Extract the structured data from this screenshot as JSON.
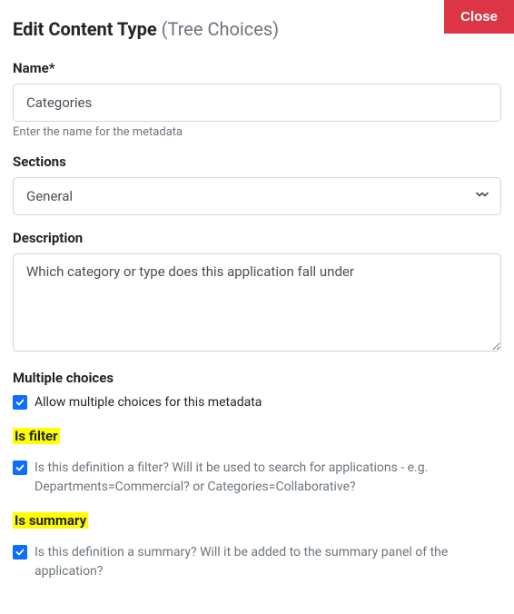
{
  "header": {
    "title": "Edit Content Type",
    "subtitle": "(Tree Choices)",
    "close_label": "Close"
  },
  "name": {
    "label": "Name*",
    "value": "Categories",
    "help": "Enter the name for the metadata"
  },
  "sections": {
    "label": "Sections",
    "value": "General"
  },
  "description": {
    "label": "Description",
    "value": "Which category or type does this application fall under"
  },
  "multiple": {
    "label": "Multiple choices",
    "check_text": "Allow multiple choices for this metadata"
  },
  "is_filter": {
    "label": "Is filter",
    "check_text": "Is this definition a filter? Will it be used to search for applications - e.g. Departments=Commercial? or Categories=Collaborative?"
  },
  "is_summary": {
    "label": "Is summary",
    "check_text": "Is this definition a summary? Will it be added to the summary panel of the application?"
  }
}
